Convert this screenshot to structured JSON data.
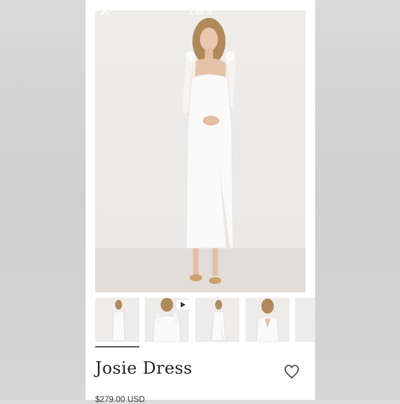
{
  "viewer": {
    "close_icon": "close-icon",
    "counter": "1 of 5"
  },
  "product": {
    "title": "Josie Dress",
    "price": "$279.00 USD",
    "wishlist_icon": "heart-icon"
  },
  "gallery": {
    "thumbnails": [
      {
        "label": "front",
        "active": true
      },
      {
        "label": "detail video",
        "video": true
      },
      {
        "label": "side"
      },
      {
        "label": "back"
      },
      {
        "label": "more"
      }
    ]
  },
  "colors": {
    "background": "#ffffff",
    "text": "#222222",
    "backdrop": "#eeece9"
  }
}
